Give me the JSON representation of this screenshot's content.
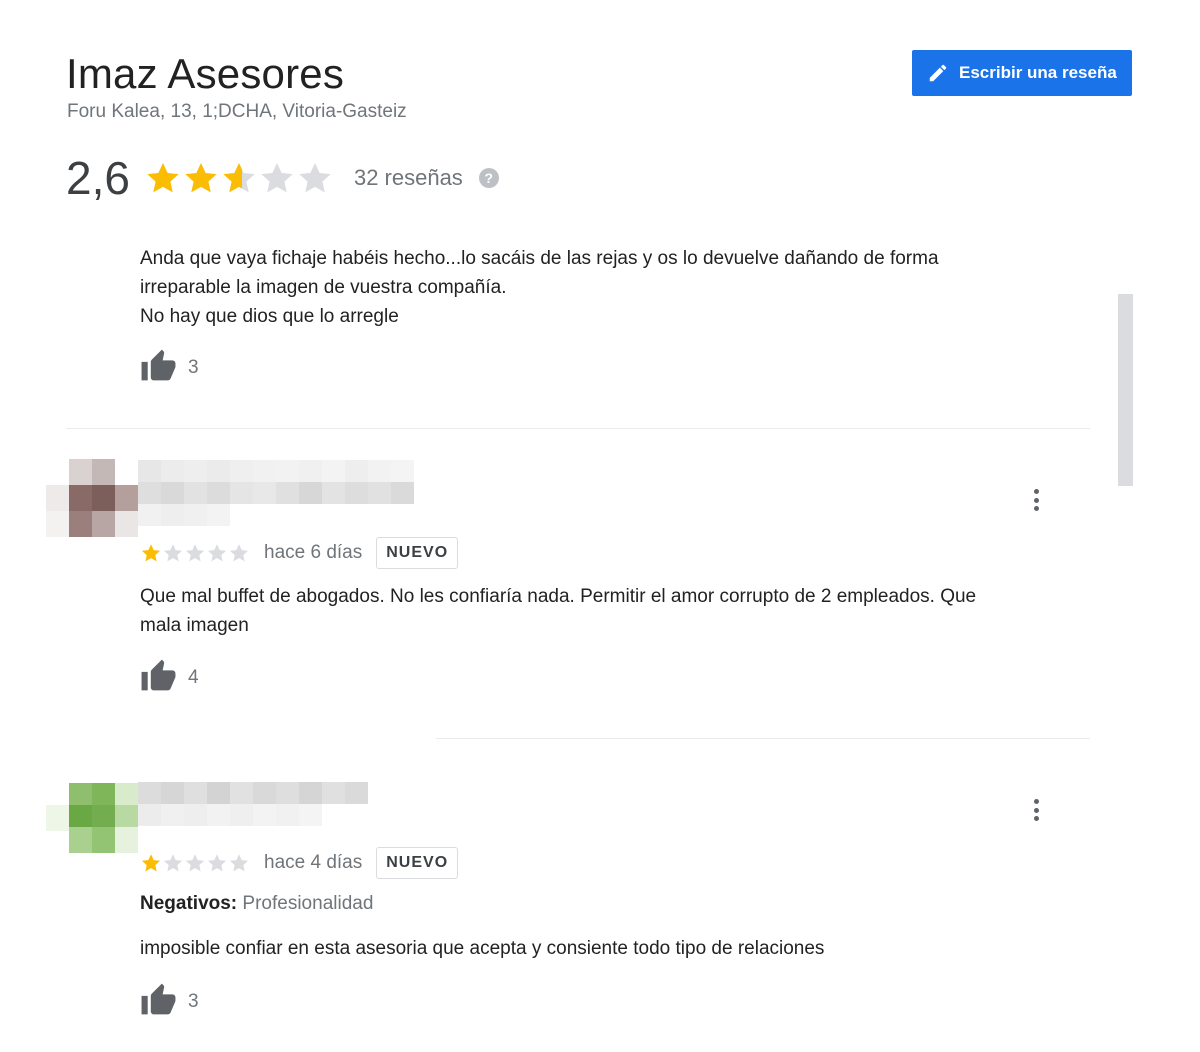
{
  "place": {
    "name": "Imaz Asesores",
    "address": "Foru Kalea, 13, 1;DCHA, Vitoria-Gasteiz"
  },
  "write_review_button": {
    "label": "Escribir una reseña",
    "icon": "pencil-icon"
  },
  "summary": {
    "rating_text": "2,6",
    "rating_value": 2.6,
    "stars_max": 5,
    "review_count_text": "32 reseñas",
    "help_icon": "?"
  },
  "colors": {
    "star_filled": "#fbbc04",
    "star_empty": "#dadce0",
    "accent": "#1a73e8"
  },
  "reviews": [
    {
      "text_lines": [
        "Anda que vaya fichaje habéis hecho...lo sacáis de las rejas y os lo devuelve dañando de forma",
        "irreparable la imagen de vuestra compañía.",
        "No hay que dios que lo arregle"
      ],
      "likes": "3"
    },
    {
      "stars": 1,
      "time": "hace 6 días",
      "badge": "NUEVO",
      "text_lines": [
        "Que mal buffet de abogados. No les confiaría nada. Permitir el amor corrupto de 2 empleados. Que",
        "mala imagen"
      ],
      "likes": "4"
    },
    {
      "stars": 1,
      "time": "hace 4 días",
      "badge": "NUEVO",
      "negatives_label": "Negativos:",
      "negatives_value": "Profesionalidad",
      "text_lines": [
        "imposible confiar en esta asesoria que acepta y consiente todo tipo de relaciones"
      ],
      "likes": "3"
    }
  ]
}
